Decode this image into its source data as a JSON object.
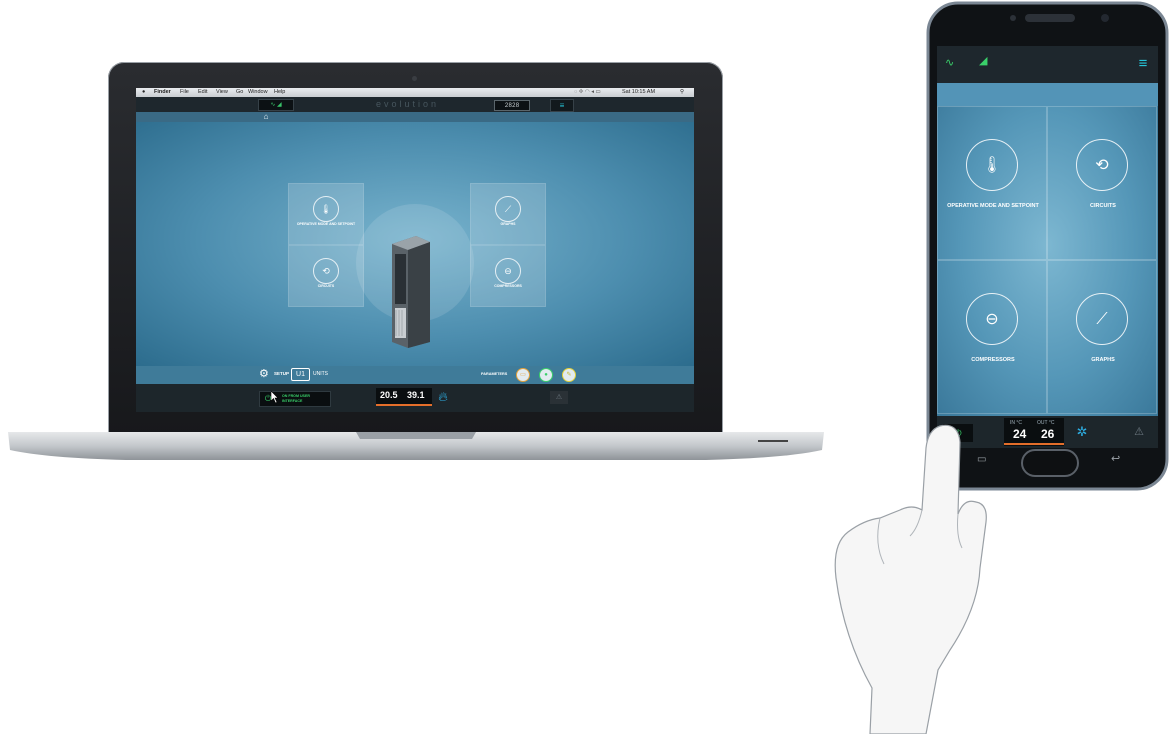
{
  "laptop": {
    "menubar": {
      "apple": "",
      "items": [
        "Finder",
        "File",
        "Edit",
        "View",
        "Go",
        "Window",
        "Help"
      ],
      "clock": "Sat 10:15 AM"
    },
    "app": {
      "logo": "evolution",
      "lcd": "2828",
      "tiles": {
        "operative": "OPERATIVE MODE AND SETPOINT",
        "graphs": "GRAPHS",
        "circuits": "CIRCUITS",
        "compressors": "COMPRESSORS"
      },
      "setup_label": "SETUP",
      "unit_code": "U1",
      "units_label": "UNITS",
      "parameters_label": "PARAMETERS",
      "power_text": "ON FROM USER INTERFACE",
      "temp_in": "20.5",
      "temp_out": "39.1"
    }
  },
  "phone": {
    "tiles": {
      "operative": "OPERATIVE MODE AND SETPOINT",
      "circuits": "CIRCUITS",
      "compressors": "COMPRESSORS",
      "graphs": "GRAPHS"
    },
    "in_label": "IN °C",
    "out_label": "OUT °C",
    "temp_in": "24",
    "temp_out": "26"
  },
  "colors": {
    "accent_green": "#3ad06a",
    "accent_cyan": "#25c4d8",
    "screen_blue": "#4d8eaf",
    "temp_bar_orange": "#e46e2a"
  }
}
